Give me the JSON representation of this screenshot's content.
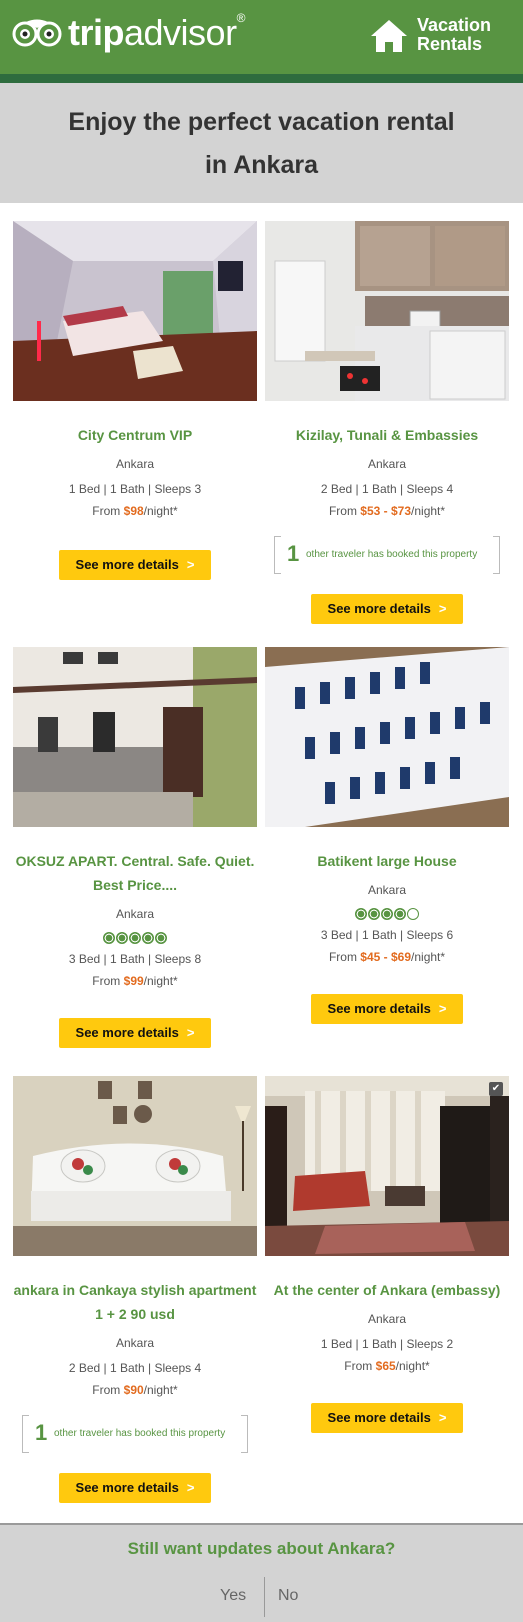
{
  "header": {
    "logo_prefix": "trip",
    "logo_suffix": "advisor",
    "logo_reg": "®",
    "section_line1": "Vacation",
    "section_line2": "Rentals",
    "brand_color": "#589442",
    "stripe_color": "#2e6c3e"
  },
  "hero": {
    "line1": "Enjoy the perfect vacation rental",
    "line2": "in Ankara"
  },
  "listings": [
    {
      "title": "City Centrum VIP",
      "city": "Ankara",
      "specs": "1 Bed | 1 Bath | Sleeps 3",
      "price_prefix": "From ",
      "price": "$98",
      "price_suffix": "/night*",
      "button": "See more details",
      "button_arrow": ">"
    },
    {
      "title": "Kizilay, Tunali & Embassies",
      "city": "Ankara",
      "specs": "2 Bed | 1 Bath | Sleeps 4",
      "price_prefix": "From ",
      "price": "$53 - $73",
      "price_suffix": "/night*",
      "booked_count": "1",
      "booked_text": "other traveler has booked this property",
      "button": "See more details",
      "button_arrow": ">"
    },
    {
      "title_line1": "OKSUZ APART. Central. Safe. Quiet.",
      "title_line2": "Best Price....",
      "city": "Ankara",
      "rating": 5,
      "specs": "3 Bed | 1 Bath | Sleeps 8",
      "price_prefix": "From ",
      "price": "$99",
      "price_suffix": "/night*",
      "button": "See more details",
      "button_arrow": ">"
    },
    {
      "title": "Batikent large House",
      "city": "Ankara",
      "rating": 4,
      "specs": "3 Bed | 1 Bath | Sleeps 6",
      "price_prefix": "From ",
      "price": "$45 - $69",
      "price_suffix": "/night*",
      "button": "See more details",
      "button_arrow": ">"
    },
    {
      "title_line1": "ankara in Cankaya stylish apartment",
      "title_line2": "1 + 2 90 usd",
      "city": "Ankara",
      "specs": "2 Bed | 1 Bath | Sleeps 4",
      "price_prefix": "From ",
      "price": "$90",
      "price_suffix": "/night*",
      "booked_count": "1",
      "booked_text": "other traveler has booked this property",
      "button": "See more details",
      "button_arrow": ">"
    },
    {
      "title": "At the center of Ankara (embassy)",
      "city": "Ankara",
      "specs": "1 Bed | 1 Bath | Sleeps 2",
      "price_prefix": "From ",
      "price": "$65",
      "price_suffix": "/night*",
      "button": "See more details",
      "button_arrow": ">",
      "badge_icon": "checkmark-icon"
    }
  ],
  "footer": {
    "question": "Still want updates about Ankara?",
    "yes": "Yes",
    "no": "No"
  },
  "colors": {
    "accent_green": "#589442",
    "price_orange": "#e26b1f",
    "button_yellow": "#ffc90e",
    "panel_gray": "#d3d3d3"
  }
}
